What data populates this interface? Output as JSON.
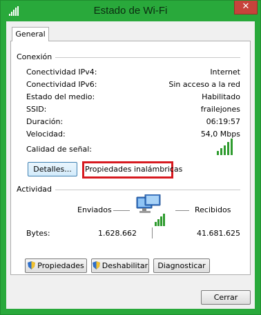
{
  "window": {
    "title": "Estado de Wi-Fi",
    "close_glyph": "✕"
  },
  "tabs": [
    "General"
  ],
  "connection": {
    "group_title": "Conexión",
    "rows": [
      {
        "label": "Conectividad IPv4:",
        "value": "Internet"
      },
      {
        "label": "Conectividad IPv6:",
        "value": "Sin acceso a la red"
      },
      {
        "label": "Estado del medio:",
        "value": "Habilitado"
      },
      {
        "label": "SSID:",
        "value": "frailejones"
      },
      {
        "label": "Duración:",
        "value": "06:19:57"
      },
      {
        "label": "Velocidad:",
        "value": "54,0 Mbps"
      }
    ],
    "signal_label": "Calidad de señal:",
    "signal_bars_lit": 5,
    "signal_bars_total": 5,
    "details_button": "Detalles...",
    "wireless_props_button": "Propiedades inalámbricas"
  },
  "activity": {
    "group_title": "Actividad",
    "sent_label": "Enviados",
    "received_label": "Recibidos",
    "bytes_label": "Bytes:",
    "bytes_sent": "1.628.662",
    "bytes_received": "41.681.625"
  },
  "action_buttons": {
    "properties": "Propiedades",
    "disable": "Deshabilitar",
    "diagnose": "Diagnosticar"
  },
  "close_button": "Cerrar",
  "colors": {
    "frame": "#29a93b",
    "signal": "#2e9b2e",
    "highlight": "#d7191f",
    "close": "#c7433b"
  }
}
